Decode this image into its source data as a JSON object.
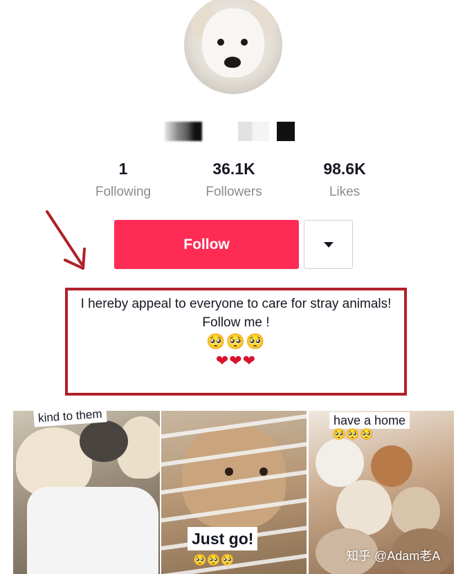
{
  "profile": {
    "username_hidden": true
  },
  "stats": [
    {
      "value": "1",
      "label": "Following"
    },
    {
      "value": "36.1K",
      "label": "Followers"
    },
    {
      "value": "98.6K",
      "label": "Likes"
    }
  ],
  "actions": {
    "follow_label": "Follow",
    "dropdown_icon": "caret-down-icon"
  },
  "bio": {
    "line1": "I hereby appeal to everyone to care for stray animals!",
    "line2": "Follow me !",
    "emoji_row1": "🥺🥺🥺",
    "emoji_row2": "❤❤❤"
  },
  "videos": [
    {
      "caption": "kind to them"
    },
    {
      "caption": "Just go!",
      "emojis": "🥺🥺🥺"
    },
    {
      "caption": "have a home",
      "emojis": "🥺🥺🥺"
    }
  ],
  "watermark": "知乎 @Adam老A",
  "colors": {
    "follow_button": "#fe2c55",
    "annotation_red": "#b0202a",
    "stat_label": "#8a8b91"
  }
}
